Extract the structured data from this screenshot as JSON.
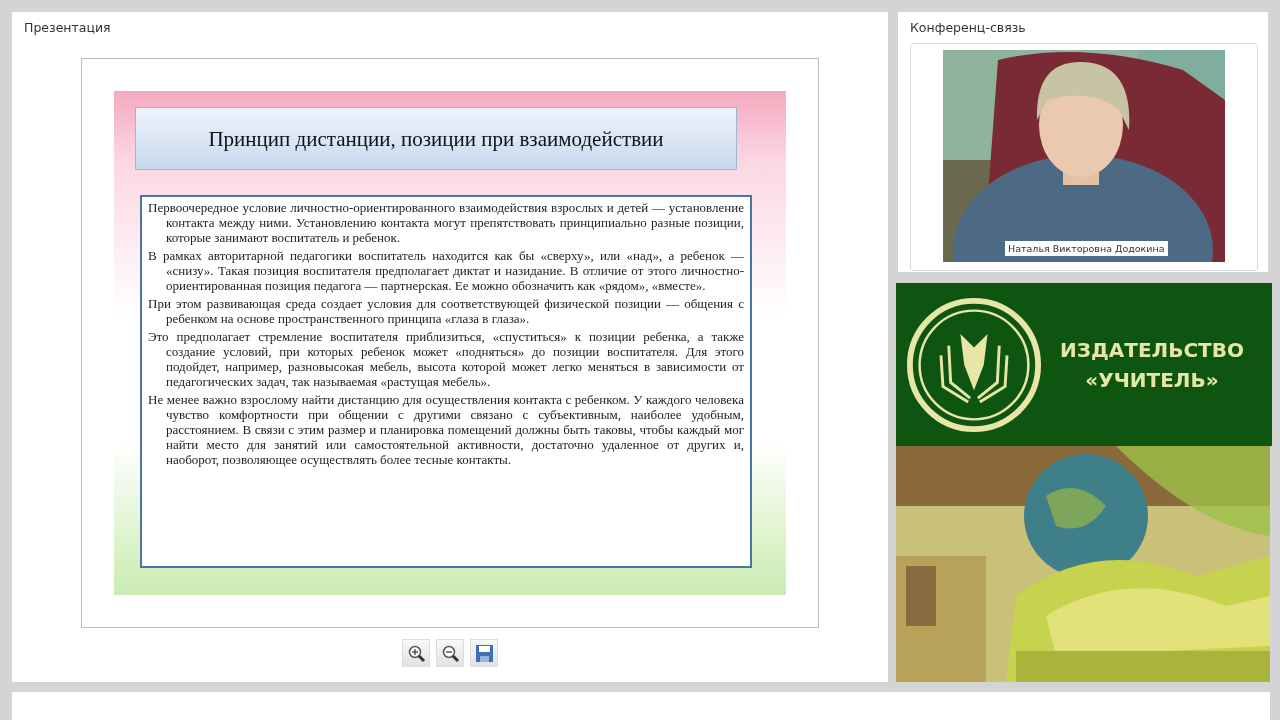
{
  "presentation": {
    "title": "Презентация",
    "slide": {
      "heading": "Принцип дистанции, позиции при взаимодействии",
      "paragraphs": [
        "Первоочередное условие личностно-ориентированного взаимодействия взрослых и детей — установление контакта между ними. Установлению контакта могут препятствовать принципиально разные позиции, которые занимают воспитатель и ребенок.",
        "В рамках авторитарной педагогики воспитатель находится как бы «сверху», или «над», а ребенок — «снизу». Такая позиция воспитателя предполагает диктат и назидание. В отличие от этого личностно-ориентированная позиция педагога — партнерская. Ее можно обозначить как «рядом», «вместе».",
        "При этом развивающая среда создает условия для соответствующей физической позиции — общения с ребенком на основе пространственного принципа «глаза в глаза».",
        "Это предполагает стремление воспитателя приблизиться, «спуститься» к позиции ребенка, а также создание условий, при которых ребенок может «подняться» до позиции воспитателя. Для этого подойдет, например, разновысокая мебель, высота которой может легко меняться в зависимости от педагогических задач, так называемая «растущая мебель».",
        "Не менее важно взрослому найти дистанцию для осуществления контакта с ребенком. У каждого человека чувство комфортности при общении с другими связано с субъективным, наиболее удобным, расстоянием. В связи с этим размер и планировка помещений должны быть таковы, чтобы каждый мог найти место для занятий или самостоятельной активности, достаточно удаленное от других и, наоборот, позволяющее осуществлять более тесные контакты."
      ]
    },
    "toolbar": [
      {
        "kind": "zoom-in"
      },
      {
        "kind": "zoom-out"
      },
      {
        "kind": "save"
      }
    ]
  },
  "conference": {
    "title": "Конференц-связь",
    "participant": {
      "name": "Наталья Викторовна Додокина"
    }
  },
  "banner": {
    "line_1": "ИЗДАТЕЛЬСТВО",
    "line_2": "«УЧИТЕЛЬ»"
  }
}
